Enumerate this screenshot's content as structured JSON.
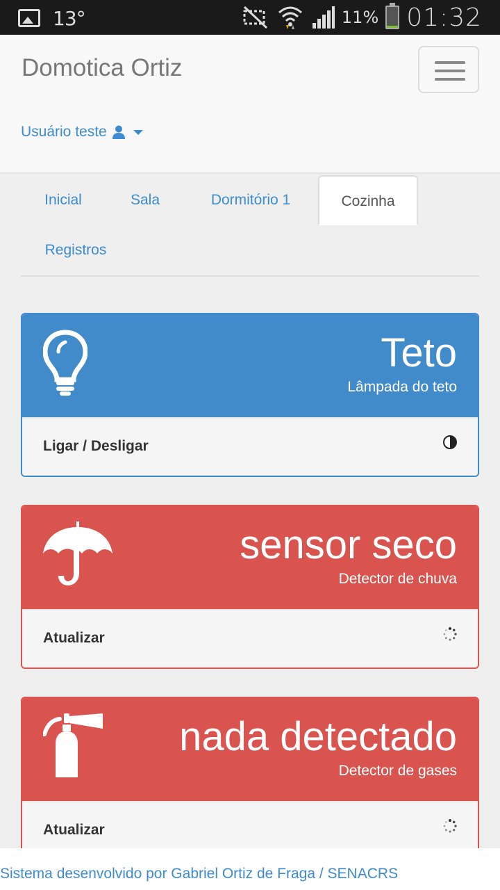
{
  "status_bar": {
    "temperature": "13°",
    "battery_percent": "11%",
    "battery_level": 0.11,
    "time": "01:32",
    "icons": [
      "image-icon",
      "mute-icon",
      "wifi-icon",
      "signal-icon",
      "battery-icon"
    ]
  },
  "navbar": {
    "brand": "Domotica Ortiz",
    "user_label": "Usuário teste",
    "menu_icon": "hamburger-icon"
  },
  "tabs": [
    {
      "label": "Inicial",
      "active": false
    },
    {
      "label": "Sala",
      "active": false
    },
    {
      "label": "Dormitório 1",
      "active": false
    },
    {
      "label": "Cozinha",
      "active": true
    },
    {
      "label": "Registros",
      "active": false
    }
  ],
  "panels": [
    {
      "title": "Teto",
      "subtitle": "Lâmpada do teto",
      "action": "Ligar / Desligar",
      "icon": "lightbulb-icon",
      "action_icon": "half-circle-icon",
      "color": "#428bca"
    },
    {
      "title": "sensor seco",
      "subtitle": "Detector de chuva",
      "action": "Atualizar",
      "icon": "umbrella-icon",
      "action_icon": "spinner-icon",
      "color": "#d9534f"
    },
    {
      "title": "nada detectado",
      "subtitle": "Detector de gases",
      "action": "Atualizar",
      "icon": "fire-extinguisher-icon",
      "action_icon": "spinner-icon",
      "color": "#d9534f"
    }
  ],
  "footer": {
    "text": "Sistema desenvolvido por Gabriel Ortiz de Fraga / SENACRS"
  },
  "colors": {
    "primary": "#428bca",
    "danger": "#d9534f",
    "link": "#3d8bd0"
  }
}
